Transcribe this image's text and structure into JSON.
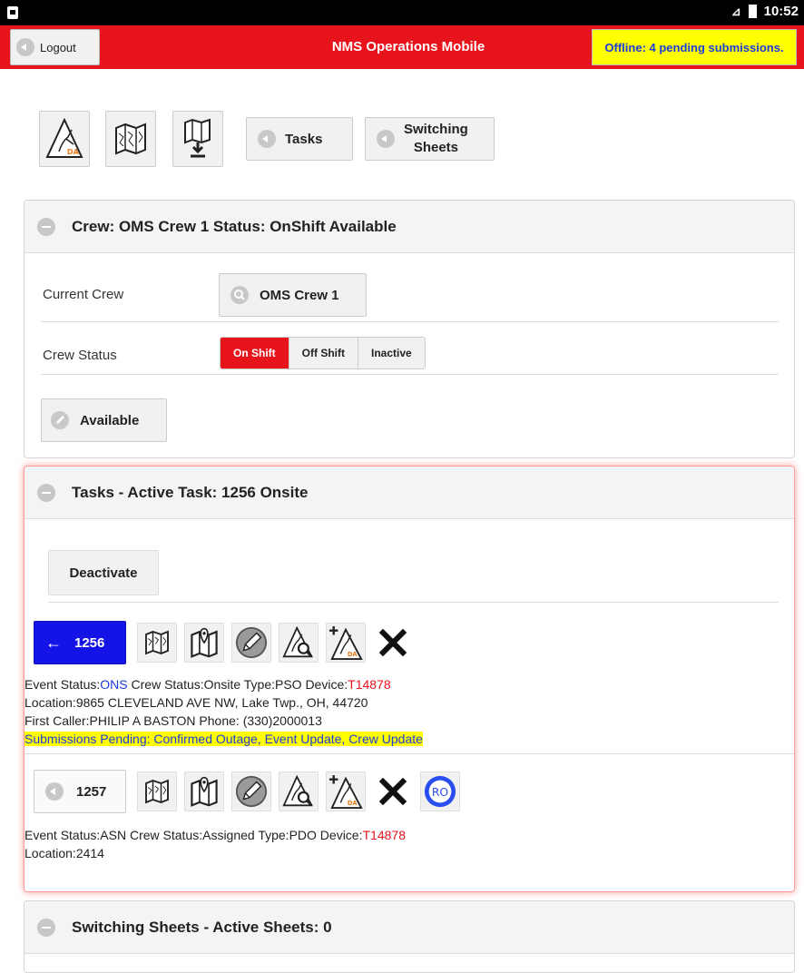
{
  "status_bar": {
    "time": "10:52"
  },
  "header": {
    "logout_label": "Logout",
    "title": "NMS Operations Mobile",
    "offline_status": "Offline: 4 pending submissions."
  },
  "toolbar": {
    "tasks_label": "Tasks",
    "switching_line1": "Switching",
    "switching_line2": "Sheets"
  },
  "crew_section": {
    "title": "Crew: OMS Crew 1 Status: OnShift Available",
    "current_crew_label": "Current Crew",
    "current_crew_value": "OMS Crew 1",
    "crew_status_label": "Crew Status",
    "status_options": [
      "On Shift",
      "Off Shift",
      "Inactive"
    ],
    "selected_status": "On Shift",
    "available_label": "Available"
  },
  "tasks_section": {
    "title": "Tasks - Active Task: 1256 Onsite",
    "deactivate_label": "Deactivate",
    "tasks": [
      {
        "id": "1256",
        "event_status_label": "Event Status:",
        "event_status": "ONS",
        "crew_status": " Crew Status:Onsite Type:PSO Device:",
        "device": "T14878",
        "location": "Location:9865 CLEVELAND AVE NW, Lake Twp., OH, 44720",
        "first_caller": "First Caller:PHILIP A BASTON Phone: (330)2000013",
        "pending": "Submissions Pending: Confirmed Outage, Event Update, Crew Update"
      },
      {
        "id": "1257",
        "event_status_label": "Event Status:",
        "event_status": "ASN",
        "crew_status": " Crew Status:Assigned Type:PDO Device:",
        "device": "T14878",
        "location": "Location:2414",
        "ro_label": "RO"
      }
    ]
  },
  "switching_section": {
    "title": "Switching Sheets - Active Sheets: 0"
  },
  "colors": {
    "header_red": "#e8141c",
    "offline_yellow": "#ffff00",
    "link_blue": "#1a3ddb",
    "active_task_blue": "#1414e6"
  }
}
